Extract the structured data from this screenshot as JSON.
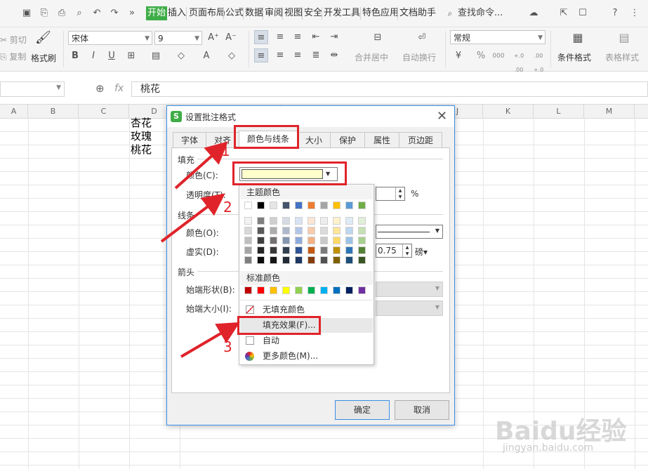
{
  "menubar": {
    "tabs": [
      "开始",
      "插入",
      "页面布局",
      "公式",
      "数据",
      "审阅",
      "视图",
      "安全",
      "开发工具",
      "特色应用",
      "文档助手"
    ],
    "active_tab": "开始",
    "search_label": "查找命令..."
  },
  "ribbon": {
    "cut": "剪切",
    "copy": "复制",
    "format_painter": "格式刷",
    "font_name": "宋体",
    "font_size": "9",
    "merge_center": "合并居中",
    "auto_wrap": "自动换行",
    "number_format": "常规",
    "conditional_format": "条件格式",
    "table_style": "表格样式",
    "percent": "%",
    "thousand": "000",
    "inc_decimal": "+.0 .00",
    "dec_decimal": ".00 +.0"
  },
  "formula_bar": {
    "fx": "fx",
    "value": "桃花"
  },
  "columns": [
    "A",
    "B",
    "C",
    "D",
    "E",
    "F",
    "G",
    "H",
    "I",
    "J",
    "K",
    "L",
    "M"
  ],
  "cells": [
    "杏花",
    "玫瑰",
    "桃花"
  ],
  "dialog": {
    "title": "设置批注格式",
    "tabs": [
      "字体",
      "对齐",
      "颜色与线条",
      "大小",
      "保护",
      "属性",
      "页边距"
    ],
    "active_tab": "颜色与线条",
    "fill_group": "填充",
    "color_label": "颜色(C):",
    "transparency_label": "透明度(T):",
    "transparency_unit": "%",
    "line_group": "线条",
    "line_color_label": "颜色(O):",
    "dash_label": "虚实(D):",
    "weight_value": "0.75",
    "weight_unit": "磅",
    "arrow_group": "箭头",
    "begin_style_label": "始端形状(B):",
    "begin_size_label": "始端大小(I):",
    "ok": "确定",
    "cancel": "取消",
    "selected_fill_color": "#ffffcc"
  },
  "popup": {
    "theme_colors_label": "主题颜色",
    "standard_colors_label": "标准颜色",
    "no_fill": "无填充颜色",
    "fill_effect": "填充效果(F)...",
    "auto": "自动",
    "more_colors": "更多颜色(M)...",
    "theme_top": [
      "#ffffff",
      "#000000",
      "#e7e6e6",
      "#44546a",
      "#4472c4",
      "#ed7d31",
      "#a5a5a5",
      "#ffc000",
      "#5b9bd5",
      "#70ad47"
    ],
    "theme_shades": [
      [
        "#f2f2f2",
        "#7f7f7f",
        "#d0cece",
        "#d6dce4",
        "#d9e2f3",
        "#fbe5d5",
        "#ededed",
        "#fff2cc",
        "#deebf6",
        "#e2efd9"
      ],
      [
        "#d8d8d8",
        "#595959",
        "#aeabab",
        "#adb9ca",
        "#b4c6e7",
        "#f7cbac",
        "#dbdbdb",
        "#fee599",
        "#bdd7ee",
        "#c5e0b3"
      ],
      [
        "#bfbfbf",
        "#3f3f3f",
        "#757070",
        "#8496b0",
        "#8eaadb",
        "#f4b183",
        "#c9c9c9",
        "#ffd965",
        "#9cc3e5",
        "#a8d08d"
      ],
      [
        "#a5a5a5",
        "#262626",
        "#3a3838",
        "#323f4f",
        "#2f5496",
        "#c55a11",
        "#7b7b7b",
        "#bf9000",
        "#2e75b5",
        "#538135"
      ],
      [
        "#7f7f7f",
        "#0c0c0c",
        "#171616",
        "#222a35",
        "#1f3864",
        "#843c0c",
        "#525252",
        "#7f6000",
        "#1e4e79",
        "#375623"
      ]
    ],
    "standard": [
      "#c00000",
      "#ff0000",
      "#ffc000",
      "#ffff00",
      "#92d050",
      "#00b050",
      "#00b0f0",
      "#0070c0",
      "#002060",
      "#7030a0"
    ]
  },
  "annotations": [
    "1",
    "2",
    "3"
  ],
  "watermark": {
    "brand": "Baidu经验",
    "url": "jingyan.baidu.com"
  }
}
